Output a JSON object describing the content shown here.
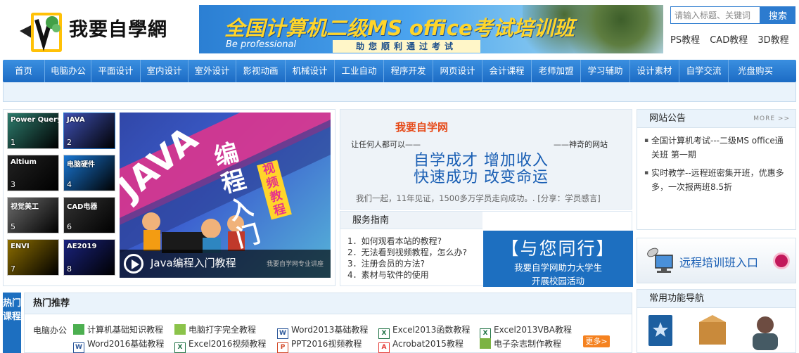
{
  "header": {
    "logo_text": "我要自學網",
    "banner_title": "全国计算机二级MS office考试培训班",
    "banner_sub": "Be professional",
    "banner_strip": "助您顺利通过考试",
    "search_placeholder": "请输入标题、关键词",
    "search_button": "搜索",
    "quick_links": [
      "PS教程",
      "CAD教程",
      "3D教程"
    ]
  },
  "nav": [
    "首页",
    "电脑办公",
    "平面设计",
    "室内设计",
    "室外设计",
    "影视动画",
    "机械设计",
    "工业自动",
    "程序开发",
    "网页设计",
    "会计课程",
    "老师加盟",
    "学习辅助",
    "设计素材",
    "自学交流",
    "光盘购买"
  ],
  "carousel": {
    "thumbs": [
      {
        "n": "1",
        "label": "Power Query",
        "color": "#2e7d6e"
      },
      {
        "n": "2",
        "label": "JAVA",
        "color": "#3f51b5"
      },
      {
        "n": "3",
        "label": "Altium",
        "color": "#222222"
      },
      {
        "n": "4",
        "label": "电脑硬件",
        "color": "#1976d2"
      },
      {
        "n": "5",
        "label": "视觉美工",
        "color": "#6d6d6d"
      },
      {
        "n": "6",
        "label": "CAD电器",
        "color": "#333333"
      },
      {
        "n": "7",
        "label": "ENVI",
        "color": "#8d6e00"
      },
      {
        "n": "8",
        "label": "AE2019",
        "color": "#1a237e"
      }
    ],
    "slide_java": "JAVA",
    "slide_zh": "编程入门",
    "slide_tag": "视频教程",
    "caption": "Java编程入门教程",
    "caption_right": "我要自学网专业讲座"
  },
  "intro": {
    "site_name": "我要自学网",
    "left_tag": "让任何人都可以——",
    "right_tag": "——神奇的网站",
    "line1": "自学成才 增加收入",
    "line2": "快速成功 改变命运",
    "footer": "我们一起，11年见证，1500多万学员走向成功。.  [分享：学员感言]"
  },
  "guide": {
    "title": "服务指南",
    "items": [
      "1．如何观看本站的教程?",
      "2．无法看到视频教程，怎么办?",
      "3．注册会员的方法?",
      "4．素材与软件的使用"
    ],
    "banner_big": "【与您同行】",
    "banner_l1": "我要自学网助力大学生",
    "banner_l2": "开展校园活动"
  },
  "notice": {
    "title": "网站公告",
    "more": "MORE >>",
    "items": [
      "全国计算机考试---二级MS office通关班 第一期",
      "实时教学--远程班密集开班，优惠多多，一次报两班8.5折"
    ]
  },
  "remote": {
    "label": "远程培训班入口"
  },
  "func": {
    "title": "常用功能导航"
  },
  "hot": {
    "tag": "热门课程",
    "title": "热门推荐",
    "category": "电脑办公",
    "more": "更多>",
    "links": [
      {
        "text": "计算机基础知识教程",
        "icon": "computer-icon",
        "glyph": "",
        "color": "#4caf50"
      },
      {
        "text": "电脑打字完全教程",
        "icon": "keyboard-icon",
        "glyph": "",
        "color": "#8bc34a"
      },
      {
        "text": "Word2013基础教程",
        "icon": "word-icon",
        "glyph": "W",
        "color": "#2b579a"
      },
      {
        "text": "Excel2013函数教程",
        "icon": "excel-icon",
        "glyph": "X",
        "color": "#217346"
      },
      {
        "text": "Excel2013VBA教程",
        "icon": "excel-icon",
        "glyph": "X",
        "color": "#217346"
      },
      {
        "text": "Word2016基础教程",
        "icon": "word-icon",
        "glyph": "W",
        "color": "#2b579a"
      },
      {
        "text": "Excel2016视频教程",
        "icon": "excel-icon",
        "glyph": "X",
        "color": "#217346"
      },
      {
        "text": "PPT2016视频教程",
        "icon": "powerpoint-icon",
        "glyph": "P",
        "color": "#d24726"
      },
      {
        "text": "Acrobat2015教程",
        "icon": "acrobat-icon",
        "glyph": "A",
        "color": "#e53935"
      },
      {
        "text": "电子杂志制作教程",
        "icon": "magazine-icon",
        "glyph": "",
        "color": "#7cb342"
      }
    ]
  }
}
